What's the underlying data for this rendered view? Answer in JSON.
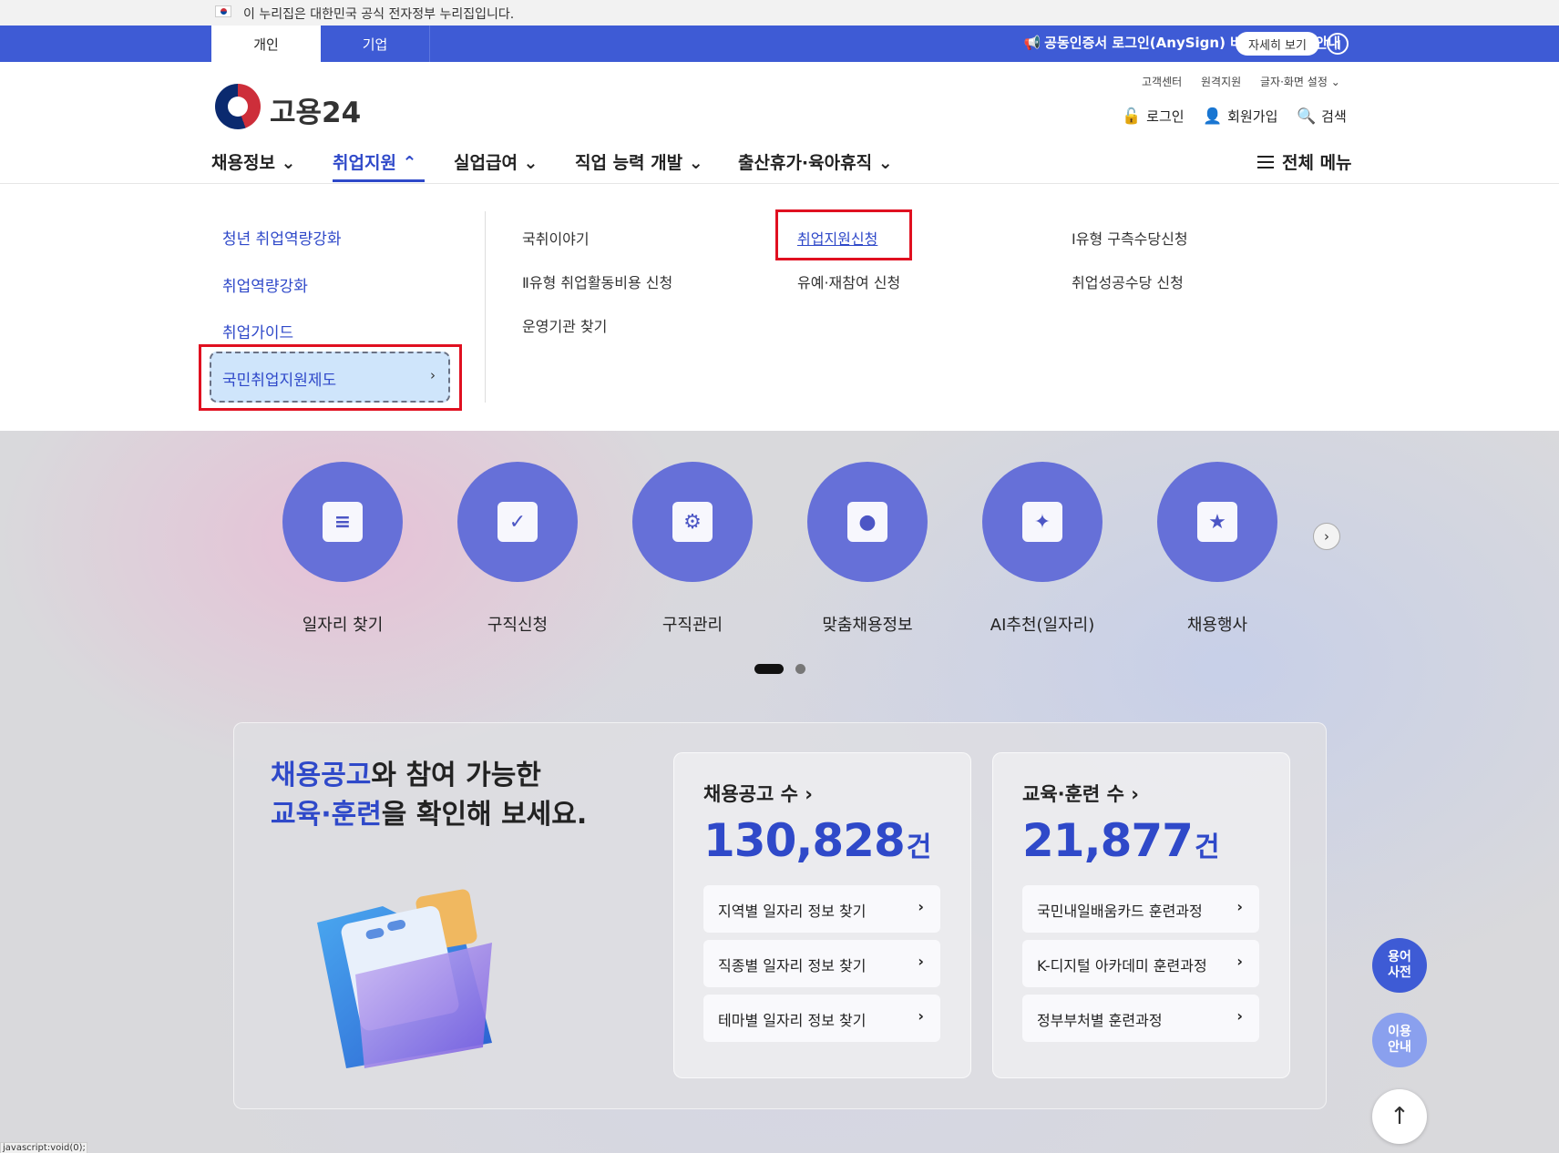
{
  "gov_bar": {
    "text": "이 누리집은 대한민국 공식 전자정부 누리집입니다."
  },
  "top_tabs": [
    {
      "label": "개인"
    },
    {
      "label": "기업"
    }
  ],
  "notice": {
    "text": "공동인증서 로그인(AnySign) 버전 업데이트 안내",
    "more_label": "자세히 보기"
  },
  "brand": {
    "name": "고용24"
  },
  "utility_links": [
    "고객센터",
    "원격지원",
    "글자·화면 설정"
  ],
  "user_menu": [
    "로그인",
    "회원가입",
    "검색"
  ],
  "gnb": [
    "채용정보",
    "취업지원",
    "실업급여",
    "직업 능력 개발",
    "출산휴가·육아휴직"
  ],
  "all_menu_label": "전체 메뉴",
  "submenu_left": [
    "청년 취업역량강화",
    "취업역량강화",
    "취업가이드",
    "국민취업지원제도"
  ],
  "submenu_items": [
    "국취이야기",
    "취업지원신청",
    "Ⅰ유형 구측수당신청",
    "Ⅱ유형 취업활동비용 신청",
    "유예·재참여 신청",
    "취업성공수당 신청",
    "운영기관 찾기"
  ],
  "quick_menu": [
    "일자리 찾기",
    "구직신청",
    "구직관리",
    "맞춤채용정보",
    "AI추천(일자리)",
    "채용행사"
  ],
  "headline": {
    "accent1": "채용공고",
    "rest1": "와 참여 가능한",
    "accent2": "교육·훈련",
    "rest2": "을 확인해 보세요."
  },
  "stats": [
    {
      "title": "채용공고 수",
      "value": "130,828",
      "unit": "건",
      "links": [
        "지역별 일자리 정보 찾기",
        "직종별 일자리 정보 찾기",
        "테마별 일자리 정보 찾기"
      ]
    },
    {
      "title": "교육·훈련 수",
      "value": "21,877",
      "unit": "건",
      "links": [
        "국민내일배움카드 훈련과정",
        "K-디지털 아카데미 훈련과정",
        "정부부처별 훈련과정"
      ]
    }
  ],
  "floating": {
    "dictionary_line1": "용어",
    "dictionary_line2": "사전",
    "guide_line1": "이용",
    "guide_line2": "안내"
  },
  "status_bar": "javascript:void(0);",
  "colors": {
    "primary": "#3e5bd5",
    "accent": "#2f49c9",
    "highlight": "#e01020"
  }
}
